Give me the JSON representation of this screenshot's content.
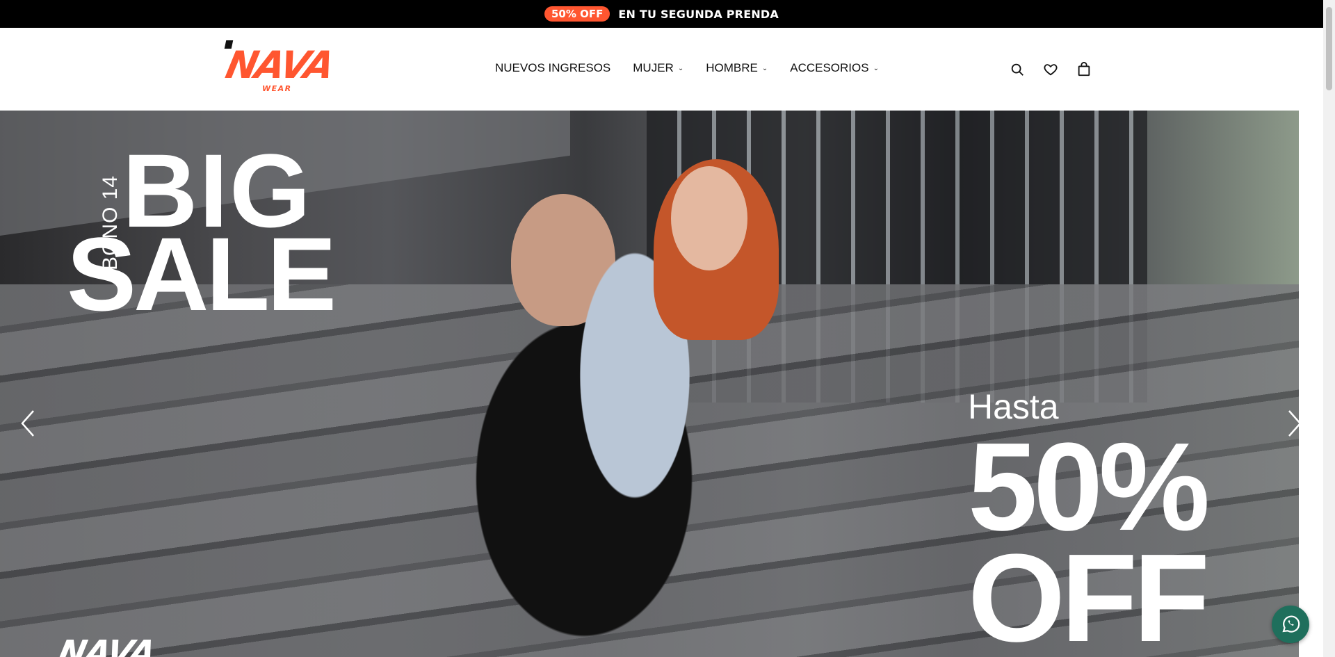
{
  "announcement": {
    "badge": "50% OFF",
    "message": "EN TU SEGUNDA PRENDA"
  },
  "brand": {
    "logo_text": "NAVA",
    "logo_sub": "WEAR",
    "accent_color": "#ff5630"
  },
  "nav": {
    "items": [
      {
        "label": "NUEVOS INGRESOS",
        "has_dropdown": false
      },
      {
        "label": "MUJER",
        "has_dropdown": true
      },
      {
        "label": "HOMBRE",
        "has_dropdown": true
      },
      {
        "label": "ACCESORIOS",
        "has_dropdown": true
      }
    ]
  },
  "header_icons": [
    "search-icon",
    "heart-icon",
    "bag-icon"
  ],
  "hero": {
    "bono": "BONO 14",
    "big": "BIG",
    "sale": "SALE",
    "hasta": "Hasta",
    "percent": "50%",
    "off": "OFF",
    "bottom_logo": "NAVA"
  },
  "whatsapp_color": "#1f6f5c"
}
